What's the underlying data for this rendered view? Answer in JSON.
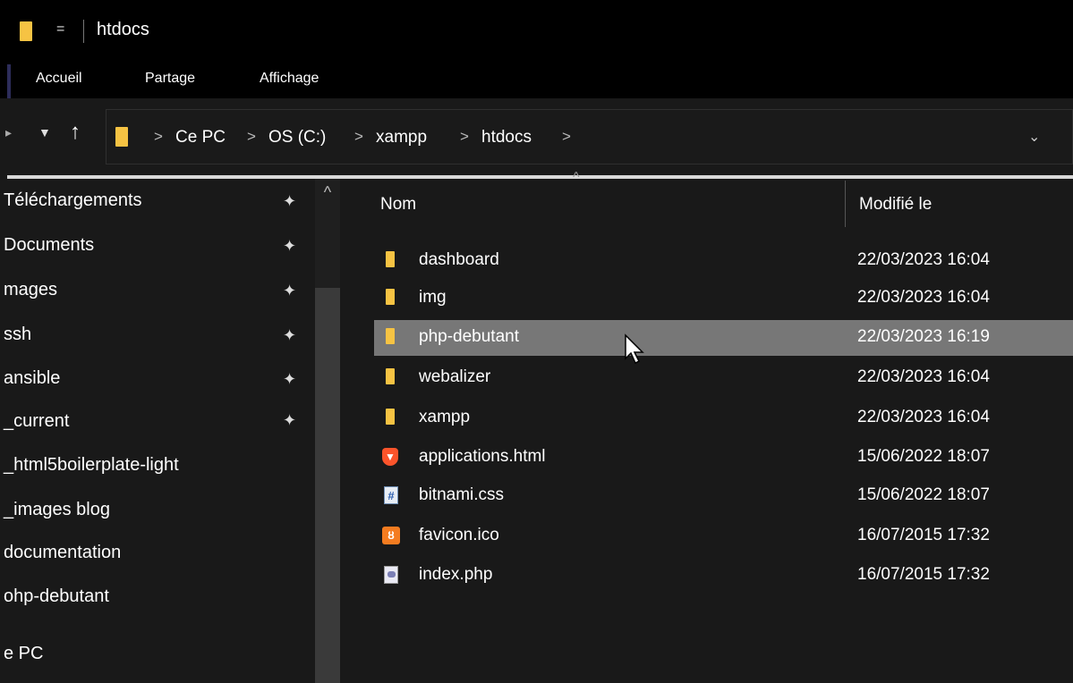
{
  "window": {
    "title": "htdocs",
    "quick_access_separator": "="
  },
  "ribbon": {
    "tabs": [
      {
        "label": "Accueil"
      },
      {
        "label": "Partage"
      },
      {
        "label": "Affichage"
      }
    ]
  },
  "address": {
    "breadcrumbs": [
      "Ce PC",
      "OS (C:)",
      "xampp",
      "htdocs"
    ],
    "separator": ">",
    "dropdown_icon": "chevron-down-icon"
  },
  "navigation": {
    "items": [
      {
        "label": "Téléchargements",
        "pinned": true
      },
      {
        "label": "Documents",
        "pinned": true
      },
      {
        "label": "mages",
        "pinned": true
      },
      {
        "label": "ssh",
        "pinned": true
      },
      {
        "label": "ansible",
        "pinned": true
      },
      {
        "label": "_current",
        "pinned": true
      },
      {
        "label": "_html5boilerplate-light",
        "pinned": false
      },
      {
        "label": "_images blog",
        "pinned": false
      },
      {
        "label": "documentation",
        "pinned": false
      },
      {
        "label": "ohp-debutant",
        "pinned": false
      },
      {
        "label": "e PC",
        "pinned": false
      }
    ]
  },
  "file_list": {
    "columns": {
      "name": "Nom",
      "modified": "Modifié le"
    },
    "rows": [
      {
        "name": "dashboard",
        "modified": "22/03/2023 16:04",
        "type": "folder",
        "selected": false
      },
      {
        "name": "img",
        "modified": "22/03/2023 16:04",
        "type": "folder",
        "selected": false
      },
      {
        "name": "php-debutant",
        "modified": "22/03/2023 16:19",
        "type": "folder",
        "selected": true
      },
      {
        "name": "webalizer",
        "modified": "22/03/2023 16:04",
        "type": "folder",
        "selected": false
      },
      {
        "name": "xampp",
        "modified": "22/03/2023 16:04",
        "type": "folder",
        "selected": false
      },
      {
        "name": "applications.html",
        "modified": "15/06/2022 18:07",
        "type": "brave-html",
        "selected": false
      },
      {
        "name": "bitnami.css",
        "modified": "15/06/2022 18:07",
        "type": "css",
        "selected": false
      },
      {
        "name": "favicon.ico",
        "modified": "16/07/2015 17:32",
        "type": "xampp-ico",
        "selected": false
      },
      {
        "name": "index.php",
        "modified": "16/07/2015 17:32",
        "type": "php",
        "selected": false
      }
    ]
  },
  "colors": {
    "background": "#191919",
    "titlebar": "#000000",
    "selection": "#777777",
    "folder": "#f6c343"
  }
}
